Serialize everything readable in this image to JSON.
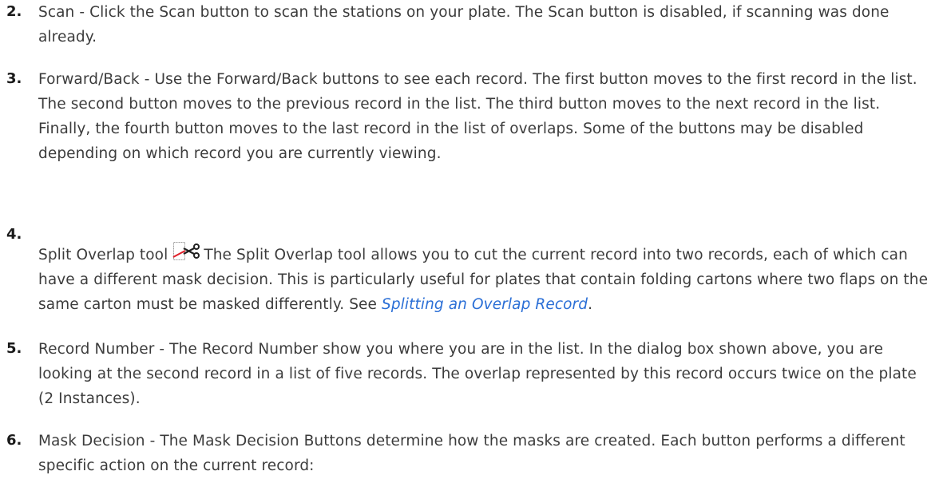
{
  "items": [
    {
      "number": "2.",
      "text": "Scan - Click the Scan button to scan the stations on your plate. The Scan button is disabled, if scanning was done already."
    },
    {
      "number": "3.",
      "text": "Forward/Back - Use the Forward/Back buttons to see each record. The first button moves to the first record in the list. The second button moves to the previous record in the list. The third button moves to the next record in the list. Finally, the fourth button moves to the last record in the list of overlaps. Some of the buttons may be disabled depending on which record you are currently viewing."
    },
    {
      "number": "4.",
      "lead": "Split Overlap tool",
      "icon": "split-overlap-scissors-icon",
      "text": "The Split Overlap tool allows you to cut the current record into two records, each of which can have a different mask decision. This is particularly useful for plates that contain folding cartons where two flaps on the same carton must be masked differently. See ",
      "link": "Splitting an Overlap Record",
      "trail": "."
    },
    {
      "number": "5.",
      "text": "Record Number - The Record Number show you where you are in the list. In the dialog box shown above, you are looking at the second record in a list of five records. The overlap represented by this record occurs twice on the plate (2 Instances)."
    },
    {
      "number": "6.",
      "text": "Mask Decision - The Mask Decision Buttons determine how the masks are created. Each button performs a different specific action on the current record:"
    }
  ],
  "colors": {
    "text": "#3c3c3c",
    "link": "#2b6fd6"
  }
}
